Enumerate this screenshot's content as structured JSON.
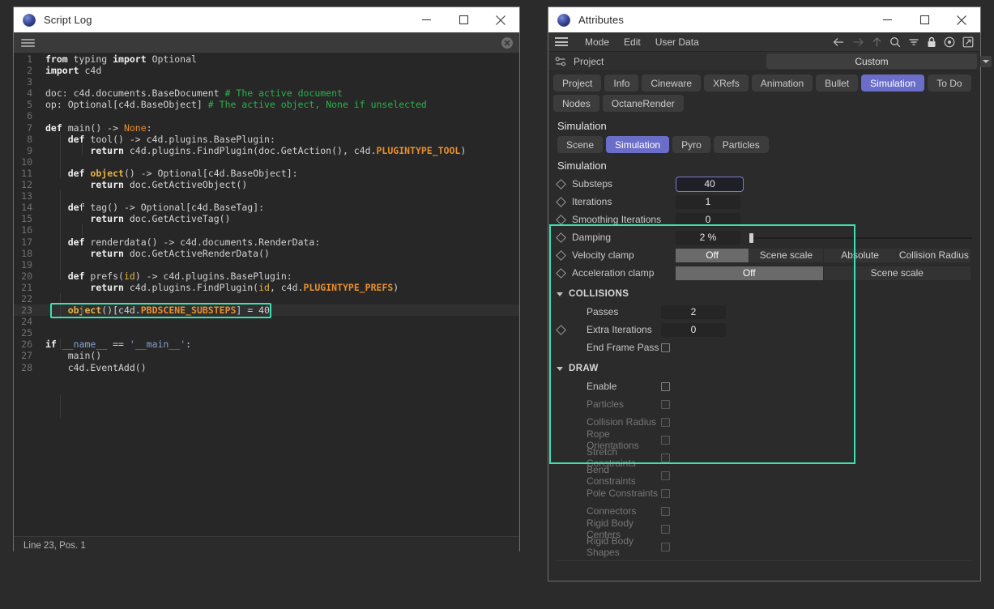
{
  "script_log": {
    "title": "Script Log",
    "window_buttons": {
      "minimize": "minimize-icon",
      "maximize": "maximize-icon",
      "close": "close-icon"
    },
    "toolbar": {
      "menu": "hamburger-icon",
      "close": "close-circle-icon"
    },
    "status": "Line 23, Pos. 1",
    "highlighted_line": 23,
    "lines": [
      {
        "n": 1,
        "parts": [
          {
            "t": "from",
            "c": "kw"
          },
          {
            "t": " typing ",
            "c": "plain"
          },
          {
            "t": "import",
            "c": "kw"
          },
          {
            "t": " Optional",
            "c": "plain"
          }
        ]
      },
      {
        "n": 2,
        "parts": [
          {
            "t": "import",
            "c": "kw"
          },
          {
            "t": " c4d",
            "c": "plain"
          }
        ]
      },
      {
        "n": 3,
        "parts": []
      },
      {
        "n": 4,
        "parts": [
          {
            "t": "doc: c4d.documents.BaseDocument ",
            "c": "plain"
          },
          {
            "t": "# The active document",
            "c": "cmt"
          }
        ]
      },
      {
        "n": 5,
        "parts": [
          {
            "t": "op: Optional[c4d.BaseObject] ",
            "c": "plain"
          },
          {
            "t": "# The active object, None if unselected",
            "c": "cmt"
          }
        ]
      },
      {
        "n": 6,
        "parts": []
      },
      {
        "n": 7,
        "parts": [
          {
            "t": "def",
            "c": "kw"
          },
          {
            "t": " main() -> ",
            "c": "plain"
          },
          {
            "t": "None",
            "c": "none"
          },
          {
            "t": ":",
            "c": "plain"
          }
        ]
      },
      {
        "n": 8,
        "parts": [
          {
            "t": "    ",
            "c": "plain"
          },
          {
            "t": "def",
            "c": "kw"
          },
          {
            "t": " tool() -> c4d.plugins.BasePlugin:",
            "c": "plain"
          }
        ]
      },
      {
        "n": 9,
        "parts": [
          {
            "t": "        ",
            "c": "plain"
          },
          {
            "t": "return",
            "c": "kw"
          },
          {
            "t": " c4d.plugins.FindPlugin(doc.GetAction(), c4d.",
            "c": "plain"
          },
          {
            "t": "PLUGINTYPE_TOOL",
            "c": "const"
          },
          {
            "t": ")",
            "c": "plain"
          }
        ]
      },
      {
        "n": 10,
        "parts": []
      },
      {
        "n": 11,
        "parts": [
          {
            "t": "    ",
            "c": "plain"
          },
          {
            "t": "def",
            "c": "kw"
          },
          {
            "t": " ",
            "c": "plain"
          },
          {
            "t": "object",
            "c": "fn"
          },
          {
            "t": "() -> Optional[c4d.BaseObject]:",
            "c": "plain"
          }
        ]
      },
      {
        "n": 12,
        "parts": [
          {
            "t": "        ",
            "c": "plain"
          },
          {
            "t": "return",
            "c": "kw"
          },
          {
            "t": " doc.GetActiveObject()",
            "c": "plain"
          }
        ]
      },
      {
        "n": 13,
        "parts": []
      },
      {
        "n": 14,
        "parts": [
          {
            "t": "    ",
            "c": "plain"
          },
          {
            "t": "def",
            "c": "kw"
          },
          {
            "t": " tag() -> Optional[c4d.BaseTag]:",
            "c": "plain"
          }
        ]
      },
      {
        "n": 15,
        "parts": [
          {
            "t": "        ",
            "c": "plain"
          },
          {
            "t": "return",
            "c": "kw"
          },
          {
            "t": " doc.GetActiveTag()",
            "c": "plain"
          }
        ]
      },
      {
        "n": 16,
        "parts": []
      },
      {
        "n": 17,
        "parts": [
          {
            "t": "    ",
            "c": "plain"
          },
          {
            "t": "def",
            "c": "kw"
          },
          {
            "t": " renderdata() -> c4d.documents.RenderData:",
            "c": "plain"
          }
        ]
      },
      {
        "n": 18,
        "parts": [
          {
            "t": "        ",
            "c": "plain"
          },
          {
            "t": "return",
            "c": "kw"
          },
          {
            "t": " doc.GetActiveRenderData()",
            "c": "plain"
          }
        ]
      },
      {
        "n": 19,
        "parts": []
      },
      {
        "n": 20,
        "parts": [
          {
            "t": "    ",
            "c": "plain"
          },
          {
            "t": "def",
            "c": "kw"
          },
          {
            "t": " prefs(",
            "c": "plain"
          },
          {
            "t": "id",
            "c": "arg"
          },
          {
            "t": ") -> c4d.plugins.BasePlugin:",
            "c": "plain"
          }
        ]
      },
      {
        "n": 21,
        "parts": [
          {
            "t": "        ",
            "c": "plain"
          },
          {
            "t": "return",
            "c": "kw"
          },
          {
            "t": " c4d.plugins.FindPlugin(",
            "c": "plain"
          },
          {
            "t": "id",
            "c": "arg"
          },
          {
            "t": ", c4d.",
            "c": "plain"
          },
          {
            "t": "PLUGINTYPE_PREFS",
            "c": "const"
          },
          {
            "t": ")",
            "c": "plain"
          }
        ]
      },
      {
        "n": 22,
        "parts": []
      },
      {
        "n": 23,
        "parts": [
          {
            "t": "    ",
            "c": "plain"
          },
          {
            "t": "object",
            "c": "fn"
          },
          {
            "t": "()[c4d.",
            "c": "plain"
          },
          {
            "t": "PBDSCENE_SUBSTEPS",
            "c": "const"
          },
          {
            "t": "] = 40",
            "c": "plain"
          }
        ]
      },
      {
        "n": 24,
        "parts": []
      },
      {
        "n": 25,
        "parts": []
      },
      {
        "n": 26,
        "parts": [
          {
            "t": "if",
            "c": "kw"
          },
          {
            "t": " ",
            "c": "plain"
          },
          {
            "t": "__name__",
            "c": "dunder"
          },
          {
            "t": " == ",
            "c": "plain"
          },
          {
            "t": "'__main__'",
            "c": "str"
          },
          {
            "t": ":",
            "c": "plain"
          }
        ]
      },
      {
        "n": 27,
        "parts": [
          {
            "t": "    main()",
            "c": "plain"
          }
        ]
      },
      {
        "n": 28,
        "parts": [
          {
            "t": "    c4d.EventAdd()",
            "c": "plain"
          }
        ]
      }
    ]
  },
  "attributes": {
    "title": "Attributes",
    "menu": [
      "Mode",
      "Edit",
      "User Data"
    ],
    "toolbar_icons": [
      "back-arrow-icon",
      "forward-arrow-icon",
      "up-arrow-icon",
      "search-icon",
      "filter-icon",
      "lock-icon",
      "target-icon",
      "external-link-icon"
    ],
    "project": {
      "icon": "sliders-icon",
      "label": "Project",
      "value": "Custom"
    },
    "tabs_row1": [
      {
        "label": "Project",
        "active": false
      },
      {
        "label": "Info",
        "active": false
      },
      {
        "label": "Cineware",
        "active": false
      },
      {
        "label": "XRefs",
        "active": false
      },
      {
        "label": "Animation",
        "active": false
      },
      {
        "label": "Bullet",
        "active": false
      },
      {
        "label": "Simulation",
        "active": true
      },
      {
        "label": "To Do",
        "active": false
      }
    ],
    "tabs_row2": [
      {
        "label": "Nodes",
        "active": false
      },
      {
        "label": "OctaneRender",
        "active": false
      }
    ],
    "simulation": {
      "heading": "Simulation",
      "sub_tabs": [
        {
          "label": "Scene",
          "active": false
        },
        {
          "label": "Simulation",
          "active": true
        },
        {
          "label": "Pyro",
          "active": false
        },
        {
          "label": "Particles",
          "active": false
        }
      ],
      "sub_heading": "Simulation",
      "fields": [
        {
          "label": "Substeps",
          "value": "40",
          "type": "number",
          "focused": true,
          "diamond": true
        },
        {
          "label": "Iterations",
          "value": "1",
          "type": "number",
          "focused": false,
          "diamond": true
        },
        {
          "label": "Smoothing Iterations",
          "value": "0",
          "type": "number",
          "focused": false,
          "diamond": true
        },
        {
          "label": "Damping",
          "value": "2 %",
          "type": "slider",
          "focused": false,
          "diamond": true
        }
      ],
      "velocity_clamp": {
        "label": "Velocity clamp",
        "options": [
          "Off",
          "Scene scale",
          "Absolute",
          "Collision Radius"
        ],
        "selected": "Off"
      },
      "acceleration_clamp": {
        "label": "Acceleration clamp",
        "options": [
          "Off",
          "Scene scale"
        ],
        "selected": "Off"
      },
      "collisions": {
        "heading": "COLLISIONS",
        "rows": [
          {
            "label": "Passes",
            "value": "2",
            "type": "number",
            "diamond": false
          },
          {
            "label": "Extra Iterations",
            "value": "0",
            "type": "number",
            "diamond": true
          },
          {
            "label": "End Frame Pass",
            "value": "",
            "type": "checkbox",
            "checked": false,
            "diamond": false
          }
        ]
      }
    },
    "draw": {
      "heading": "DRAW",
      "rows": [
        {
          "label": "Enable",
          "checked": false,
          "dim": false
        },
        {
          "label": "Particles",
          "checked": false,
          "dim": true
        },
        {
          "label": "Collision Radius",
          "checked": false,
          "dim": true
        },
        {
          "label": "Rope Orientations",
          "checked": false,
          "dim": true
        },
        {
          "label": "Stretch Constraints",
          "checked": false,
          "dim": true
        },
        {
          "label": "Bend Constraints",
          "checked": false,
          "dim": true
        },
        {
          "label": "Pole Constraints",
          "checked": false,
          "dim": true
        },
        {
          "label": "Connectors",
          "checked": false,
          "dim": true
        },
        {
          "label": "Rigid Body Centers",
          "checked": false,
          "dim": true
        },
        {
          "label": "Rigid Body Shapes",
          "checked": false,
          "dim": true
        }
      ]
    }
  },
  "colors": {
    "accent_highlight": "#3fe0b0",
    "tab_active": "#6b6ec9",
    "desktop_bg": "#2b2b2b",
    "comment_green": "#2bb24c",
    "constant_orange": "#e98f2e"
  }
}
